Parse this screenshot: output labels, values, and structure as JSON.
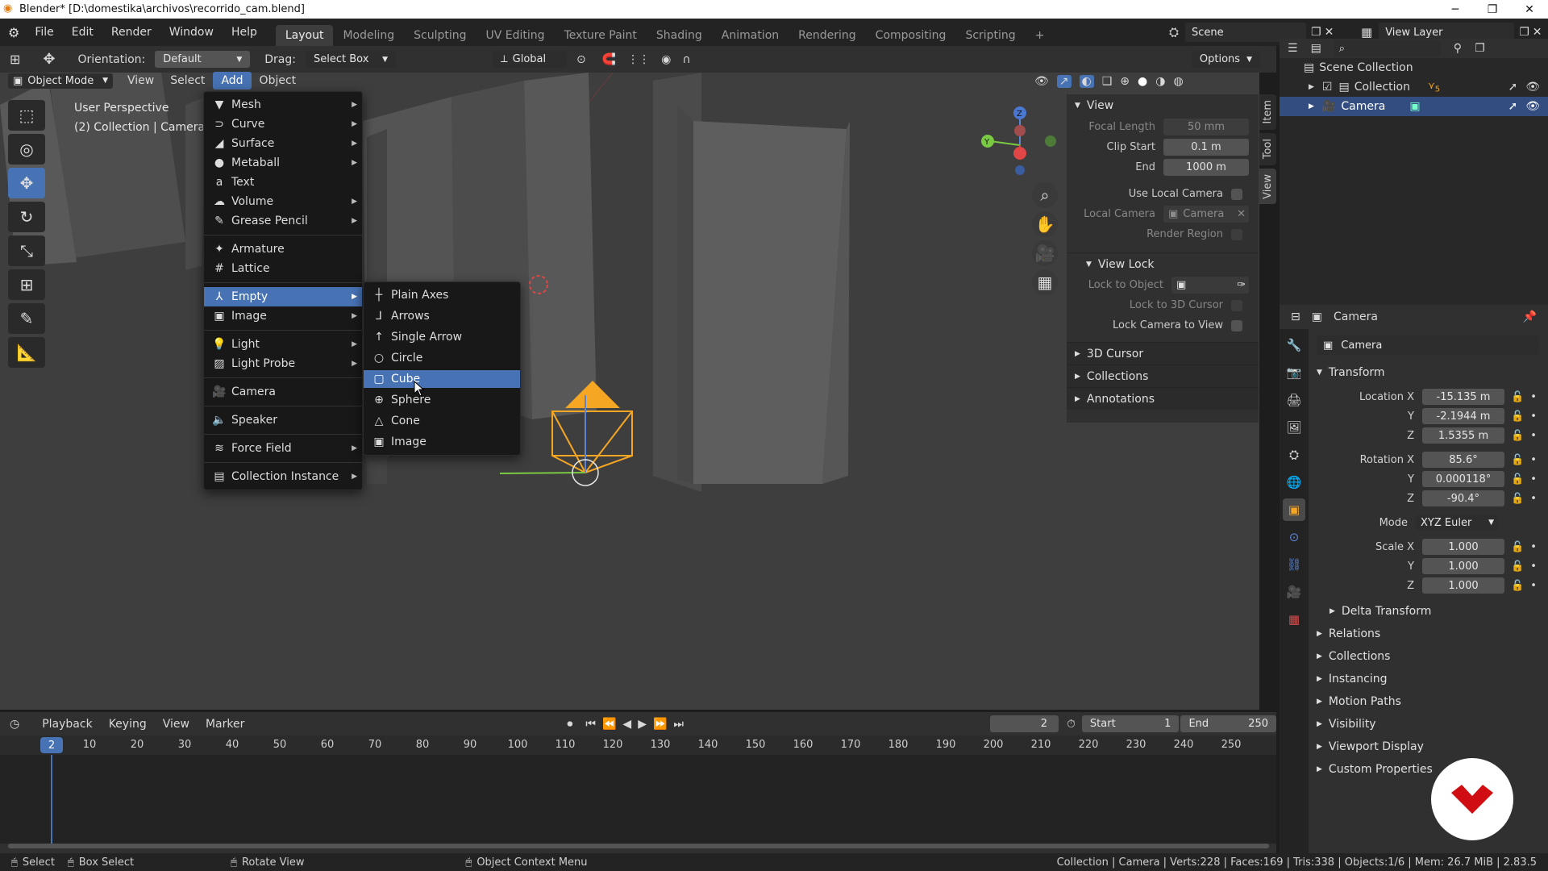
{
  "titlebar": {
    "title": "Blender* [D:\\domestika\\archivos\\recorrido_cam.blend]",
    "minimize": "─",
    "maximize": "❐",
    "close": "✕"
  },
  "menubar": {
    "items": [
      "File",
      "Edit",
      "Render",
      "Window",
      "Help"
    ],
    "workspaces": [
      "Layout",
      "Modeling",
      "Sculpting",
      "UV Editing",
      "Texture Paint",
      "Shading",
      "Animation",
      "Rendering",
      "Compositing",
      "Scripting"
    ],
    "add_ws": "+",
    "scene": "Scene",
    "view_layer": "View Layer"
  },
  "toolheader": {
    "orientation_label": "Orientation:",
    "orientation_value": "Default",
    "drag_label": "Drag:",
    "drag_value": "Select Box",
    "transform_orient": "Global",
    "options": "Options"
  },
  "viewport_header": {
    "mode": "Object Mode",
    "menus": [
      "View",
      "Select",
      "Add",
      "Object"
    ]
  },
  "viewport": {
    "perspective": "User Perspective",
    "collection_info": "(2) Collection | Camera"
  },
  "add_menu": {
    "items": [
      {
        "label": "Mesh",
        "icon": "▼",
        "sub": true
      },
      {
        "label": "Curve",
        "icon": "⊃",
        "sub": true
      },
      {
        "label": "Surface",
        "icon": "◢",
        "sub": true
      },
      {
        "label": "Metaball",
        "icon": "●",
        "sub": true
      },
      {
        "label": "Text",
        "icon": "a",
        "sub": false
      },
      {
        "label": "Volume",
        "icon": "☁",
        "sub": true
      },
      {
        "label": "Grease Pencil",
        "icon": "✎",
        "sub": true
      },
      {
        "label": "Armature",
        "icon": "✦",
        "sub": false
      },
      {
        "label": "Lattice",
        "icon": "#",
        "sub": false
      },
      {
        "label": "Empty",
        "icon": "⅄",
        "sub": true
      },
      {
        "label": "Image",
        "icon": "▣",
        "sub": true
      },
      {
        "label": "Light",
        "icon": "💡",
        "sub": true
      },
      {
        "label": "Light Probe",
        "icon": "▨",
        "sub": true
      },
      {
        "label": "Camera",
        "icon": "🎥",
        "sub": false
      },
      {
        "label": "Speaker",
        "icon": "🔈",
        "sub": false
      },
      {
        "label": "Force Field",
        "icon": "≋",
        "sub": true
      },
      {
        "label": "Collection Instance",
        "icon": "▤",
        "sub": true
      }
    ]
  },
  "empty_menu": {
    "items": [
      {
        "label": "Plain Axes",
        "icon": "┼"
      },
      {
        "label": "Arrows",
        "icon": "⅃"
      },
      {
        "label": "Single Arrow",
        "icon": "↑"
      },
      {
        "label": "Circle",
        "icon": "○"
      },
      {
        "label": "Cube",
        "icon": "▢"
      },
      {
        "label": "Sphere",
        "icon": "⊕"
      },
      {
        "label": "Cone",
        "icon": "△"
      },
      {
        "label": "Image",
        "icon": "▣"
      }
    ]
  },
  "npanel": {
    "view_hdr": "View",
    "focal_length_lbl": "Focal Length",
    "focal_length": "50 mm",
    "clip_start_lbl": "Clip Start",
    "clip_start": "0.1 m",
    "end_lbl": "End",
    "end": "1000 m",
    "use_local_camera": "Use Local Camera",
    "local_camera_lbl": "Local Camera",
    "local_camera": "Camera",
    "render_region": "Render Region",
    "view_lock_hdr": "View Lock",
    "lock_to_object": "Lock to Object",
    "lock_3d_cursor": "Lock to 3D Cursor",
    "lock_cam_view": "Lock Camera to View",
    "cursor_hdr": "3D Cursor",
    "collections_hdr": "Collections",
    "annotations_hdr": "Annotations",
    "tabs": [
      "Item",
      "Tool",
      "View"
    ]
  },
  "outliner": {
    "scene_collection": "Scene Collection",
    "collection": "Collection",
    "camera": "Camera",
    "badge": "5"
  },
  "properties": {
    "object_name_hdr": "Camera",
    "object_name": "Camera",
    "transform_hdr": "Transform",
    "location_x_lbl": "Location X",
    "location_x": "-15.135 m",
    "y_lbl": "Y",
    "location_y": "-2.1944 m",
    "z_lbl": "Z",
    "location_z": "1.5355 m",
    "rotation_x_lbl": "Rotation X",
    "rotation_x": "85.6°",
    "rotation_y": "0.000118°",
    "rotation_z": "-90.4°",
    "mode_lbl": "Mode",
    "mode": "XYZ Euler",
    "scale_x_lbl": "Scale X",
    "scale_x": "1.000",
    "scale_y": "1.000",
    "scale_z": "1.000",
    "sections": [
      "Delta Transform",
      "Relations",
      "Collections",
      "Instancing",
      "Motion Paths",
      "Visibility",
      "Viewport Display",
      "Custom Properties"
    ]
  },
  "timeline": {
    "menus": [
      "Playback",
      "Keying",
      "View",
      "Marker"
    ],
    "current_frame": "2",
    "start_lbl": "Start",
    "start": "1",
    "end_lbl": "End",
    "end": "250",
    "ticks": [
      "10",
      "20",
      "30",
      "40",
      "50",
      "60",
      "70",
      "80",
      "90",
      "100",
      "110",
      "120",
      "130",
      "140",
      "150",
      "160",
      "170",
      "180",
      "190",
      "200",
      "210",
      "220",
      "230",
      "240",
      "250"
    ],
    "frame_marker": "2"
  },
  "statusbar": {
    "select": "Select",
    "box_select": "Box Select",
    "rotate_view": "Rotate View",
    "context_menu": "Object Context Menu",
    "stats": "Collection | Camera | Verts:228 | Faces:169 | Tris:338 | Objects:1/6 | Mem: 26.7 MiB | 2.83.5"
  },
  "colors": {
    "accent": "#4772b3",
    "camera_orange": "#f5a623",
    "brand_red": "#d00d12"
  }
}
